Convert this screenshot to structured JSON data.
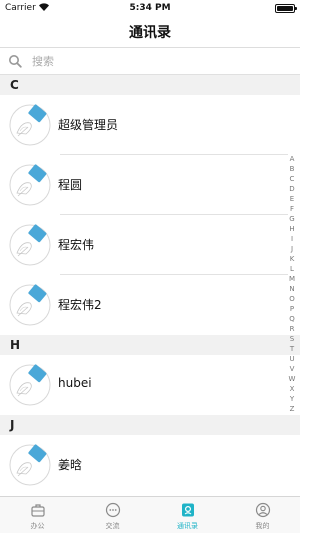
{
  "status_bar": {
    "carrier": "Carrier",
    "time": "5:34 PM"
  },
  "header": {
    "title": "通讯录"
  },
  "search": {
    "placeholder": "搜索"
  },
  "sections": [
    {
      "letter": "C",
      "contacts": [
        "超级管理员",
        "程圆",
        "程宏伟",
        "程宏伟2"
      ]
    },
    {
      "letter": "H",
      "contacts": [
        "hubei"
      ]
    },
    {
      "letter": "J",
      "contacts": [
        "姜晗"
      ]
    }
  ],
  "index_letters": [
    "A",
    "B",
    "C",
    "D",
    "E",
    "F",
    "G",
    "H",
    "I",
    "J",
    "K",
    "L",
    "M",
    "N",
    "O",
    "P",
    "Q",
    "R",
    "S",
    "T",
    "U",
    "V",
    "W",
    "X",
    "Y",
    "Z"
  ],
  "tabs": [
    {
      "label": "办公",
      "icon": "briefcase-icon",
      "active": false
    },
    {
      "label": "交流",
      "icon": "chat-icon",
      "active": false
    },
    {
      "label": "通讯录",
      "icon": "contacts-icon",
      "active": true
    },
    {
      "label": "我的",
      "icon": "profile-icon",
      "active": false
    }
  ],
  "colors": {
    "accent": "#1fb3c7",
    "avatar_pen": "#4aa8d8",
    "section_bg": "#f1f1f1"
  }
}
